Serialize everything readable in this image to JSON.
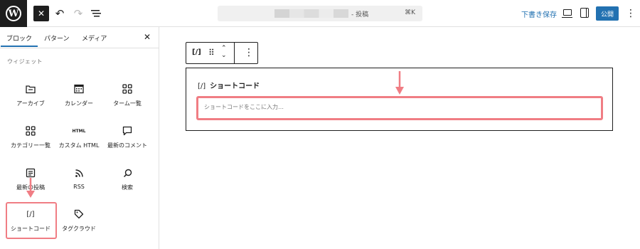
{
  "topbar": {
    "logo": "W",
    "close_icon": "close-icon",
    "undo_glyph": "↶",
    "redo_glyph": "↷",
    "doc_title": "- 投稿",
    "doc_shortcut": "⌘K",
    "save_draft": "下書き保存",
    "publish": "公開",
    "more_glyph": "⋮"
  },
  "inserter": {
    "tabs": [
      "ブロック",
      "パターン",
      "メディア"
    ],
    "active_tab": "ブロック",
    "close_glyph": "✕",
    "section_title": "ウィジェット",
    "blocks": [
      {
        "label": "アーカイブ",
        "icon": "archive-icon"
      },
      {
        "label": "カレンダー",
        "icon": "calendar-icon"
      },
      {
        "label": "ターム一覧",
        "icon": "grid-icon"
      },
      {
        "label": "カテゴリー一覧",
        "icon": "grid-icon"
      },
      {
        "label": "カスタム HTML",
        "icon": "html-icon",
        "icon_text": "HTML"
      },
      {
        "label": "最新のコメント",
        "icon": "comment-icon"
      },
      {
        "label": "最新の投稿",
        "icon": "posts-icon"
      },
      {
        "label": "RSS",
        "icon": "rss-icon"
      },
      {
        "label": "検索",
        "icon": "search-icon"
      },
      {
        "label": "ショートコード",
        "icon": "shortcode-icon",
        "icon_text": "[/]"
      },
      {
        "label": "タグクラウド",
        "icon": "tag-icon"
      }
    ]
  },
  "editor": {
    "toolbar_shortcode": "[/]",
    "toolbar_drag": "⠿",
    "toolbar_move": "⌃⌄",
    "toolbar_more": "⋮",
    "block_icon": "[/]",
    "block_title": "ショートコード",
    "input_placeholder": "ショートコードをここに入力…"
  },
  "colors": {
    "accent": "#2271b1",
    "highlight": "#f07d84",
    "dark": "#1e1e1e"
  }
}
